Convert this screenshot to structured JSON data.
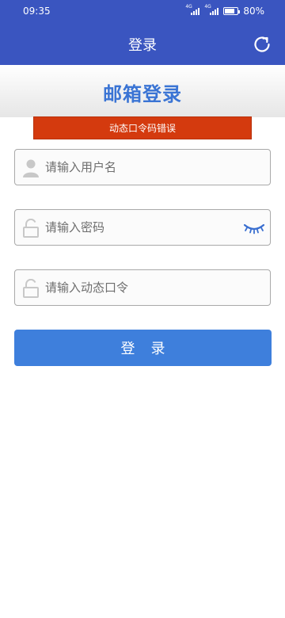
{
  "status_bar": {
    "time": "09:35",
    "signal1_tag": "4G",
    "signal2_tag": "4G",
    "battery": "80%",
    "battery_level": 0.8
  },
  "nav": {
    "title": "登录",
    "refresh_icon": "refresh-icon"
  },
  "header": {
    "title": "邮箱登录"
  },
  "error": {
    "message": "动态口令码错误"
  },
  "form": {
    "username": {
      "placeholder": "请输入用户名",
      "value": "",
      "icon": "user-icon"
    },
    "password": {
      "placeholder": "请输入密码",
      "value": "",
      "icon": "lock-icon",
      "toggle_icon": "eye-closed-icon"
    },
    "otp": {
      "placeholder": "请输入动态口令",
      "value": "",
      "icon": "lock-icon"
    }
  },
  "login_button": {
    "label": "登录"
  },
  "colors": {
    "nav_bg": "#3a55c0",
    "header_title": "#3a74d4",
    "error_bg": "#d43a0e",
    "button_bg": "#3e7fdc"
  }
}
